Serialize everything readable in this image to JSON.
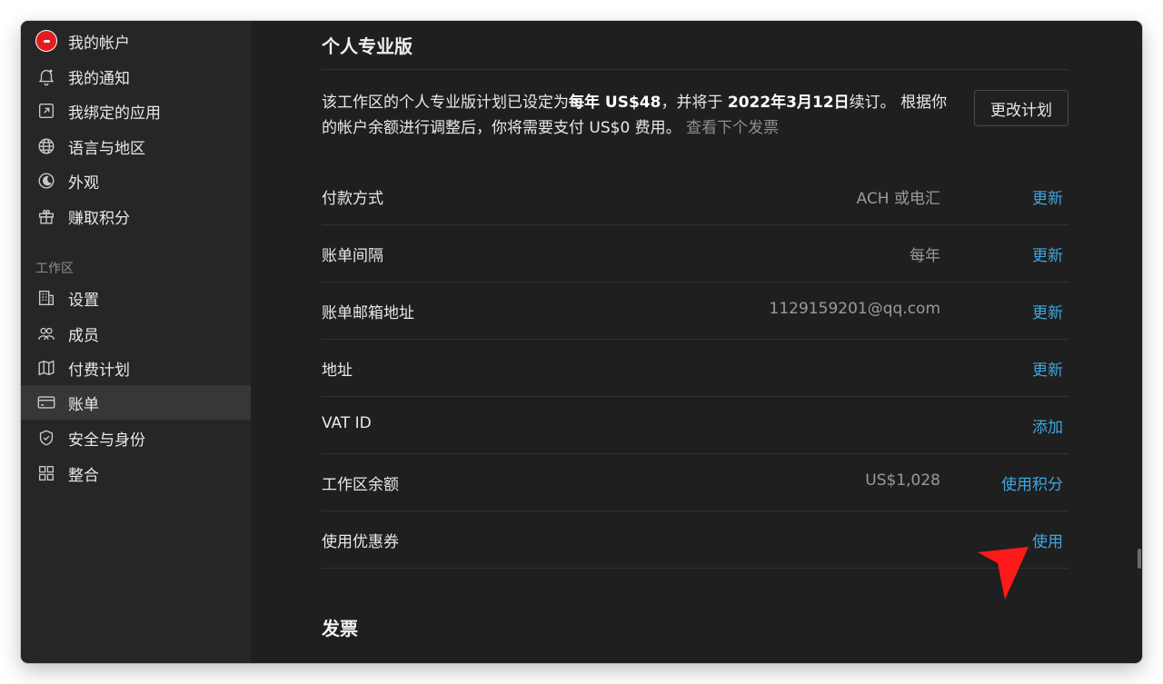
{
  "sidebar": {
    "account_items": [
      {
        "label": "我的帐户",
        "icon": "avatar"
      },
      {
        "label": "我的通知",
        "icon": "bell-icon"
      },
      {
        "label": "我绑定的应用",
        "icon": "external-link-icon"
      },
      {
        "label": "语言与地区",
        "icon": "globe-icon"
      },
      {
        "label": "外观",
        "icon": "moon-icon"
      },
      {
        "label": "赚取积分",
        "icon": "gift-icon"
      }
    ],
    "workspace_section_label": "工作区",
    "workspace_items": [
      {
        "label": "设置",
        "icon": "building-icon"
      },
      {
        "label": "成员",
        "icon": "people-icon"
      },
      {
        "label": "付费计划",
        "icon": "map-icon"
      },
      {
        "label": "账单",
        "icon": "credit-card-icon",
        "active": true
      },
      {
        "label": "安全与身份",
        "icon": "shield-icon"
      },
      {
        "label": "整合",
        "icon": "grid-icon"
      }
    ]
  },
  "main": {
    "plan_section_title": "个人专业版",
    "plan_description": {
      "part1": "该工作区的个人专业版计划已设定为",
      "bold1": "每年 US$48",
      "part2": "，并将于 ",
      "bold2": "2022年3月12日",
      "part3": "续订。 根据你的帐户余额进行调整后，你将需要支付 US$0 费用。 ",
      "next_invoice_link": "查看下个发票"
    },
    "change_plan_button": "更改计划",
    "billing_rows": [
      {
        "label": "付款方式",
        "value": "ACH 或电汇",
        "action": "更新"
      },
      {
        "label": "账单间隔",
        "value": "每年",
        "action": "更新"
      },
      {
        "label": "账单邮箱地址",
        "value": "1129159201@qq.com",
        "action": "更新"
      },
      {
        "label": "地址",
        "value": "",
        "action": "更新"
      },
      {
        "label": "VAT ID",
        "value": "",
        "action": "添加"
      },
      {
        "label": "工作区余额",
        "value": "US$1,028",
        "action": "使用积分"
      },
      {
        "label": "使用优惠券",
        "value": "",
        "action": "使用"
      }
    ],
    "invoice_section_title": "发票"
  },
  "colors": {
    "link_blue": "#3ea6e0",
    "cursor_red": "#ff1a1a",
    "background": "#1f1f1f",
    "sidebar_bg": "#262626"
  }
}
